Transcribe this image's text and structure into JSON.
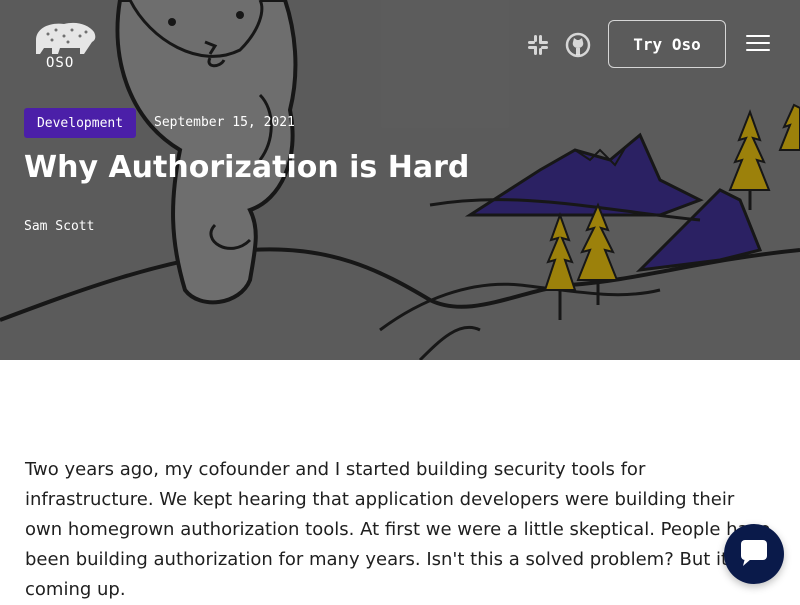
{
  "header": {
    "logo_text": "OSO",
    "try_button_label": "Try Oso",
    "icons": [
      "slack-icon",
      "github-icon",
      "menu-icon"
    ]
  },
  "post": {
    "category": "Development",
    "date": "September 15, 2021",
    "title": "Why Authorization is Hard",
    "author": "Sam Scott",
    "intro": "Two years ago, my cofounder and I started building security tools for infrastructure. We kept hearing that application developers were building their own homegrown authorization tools. At first we were a little skeptical. People have been building authorization for many years. Isn't this a solved problem? But it kept coming up."
  },
  "colors": {
    "badge": "#4b1fa8",
    "chat_button": "#0a1a4a",
    "mountains": "#2d1f7a",
    "trees": "#c9a400"
  }
}
